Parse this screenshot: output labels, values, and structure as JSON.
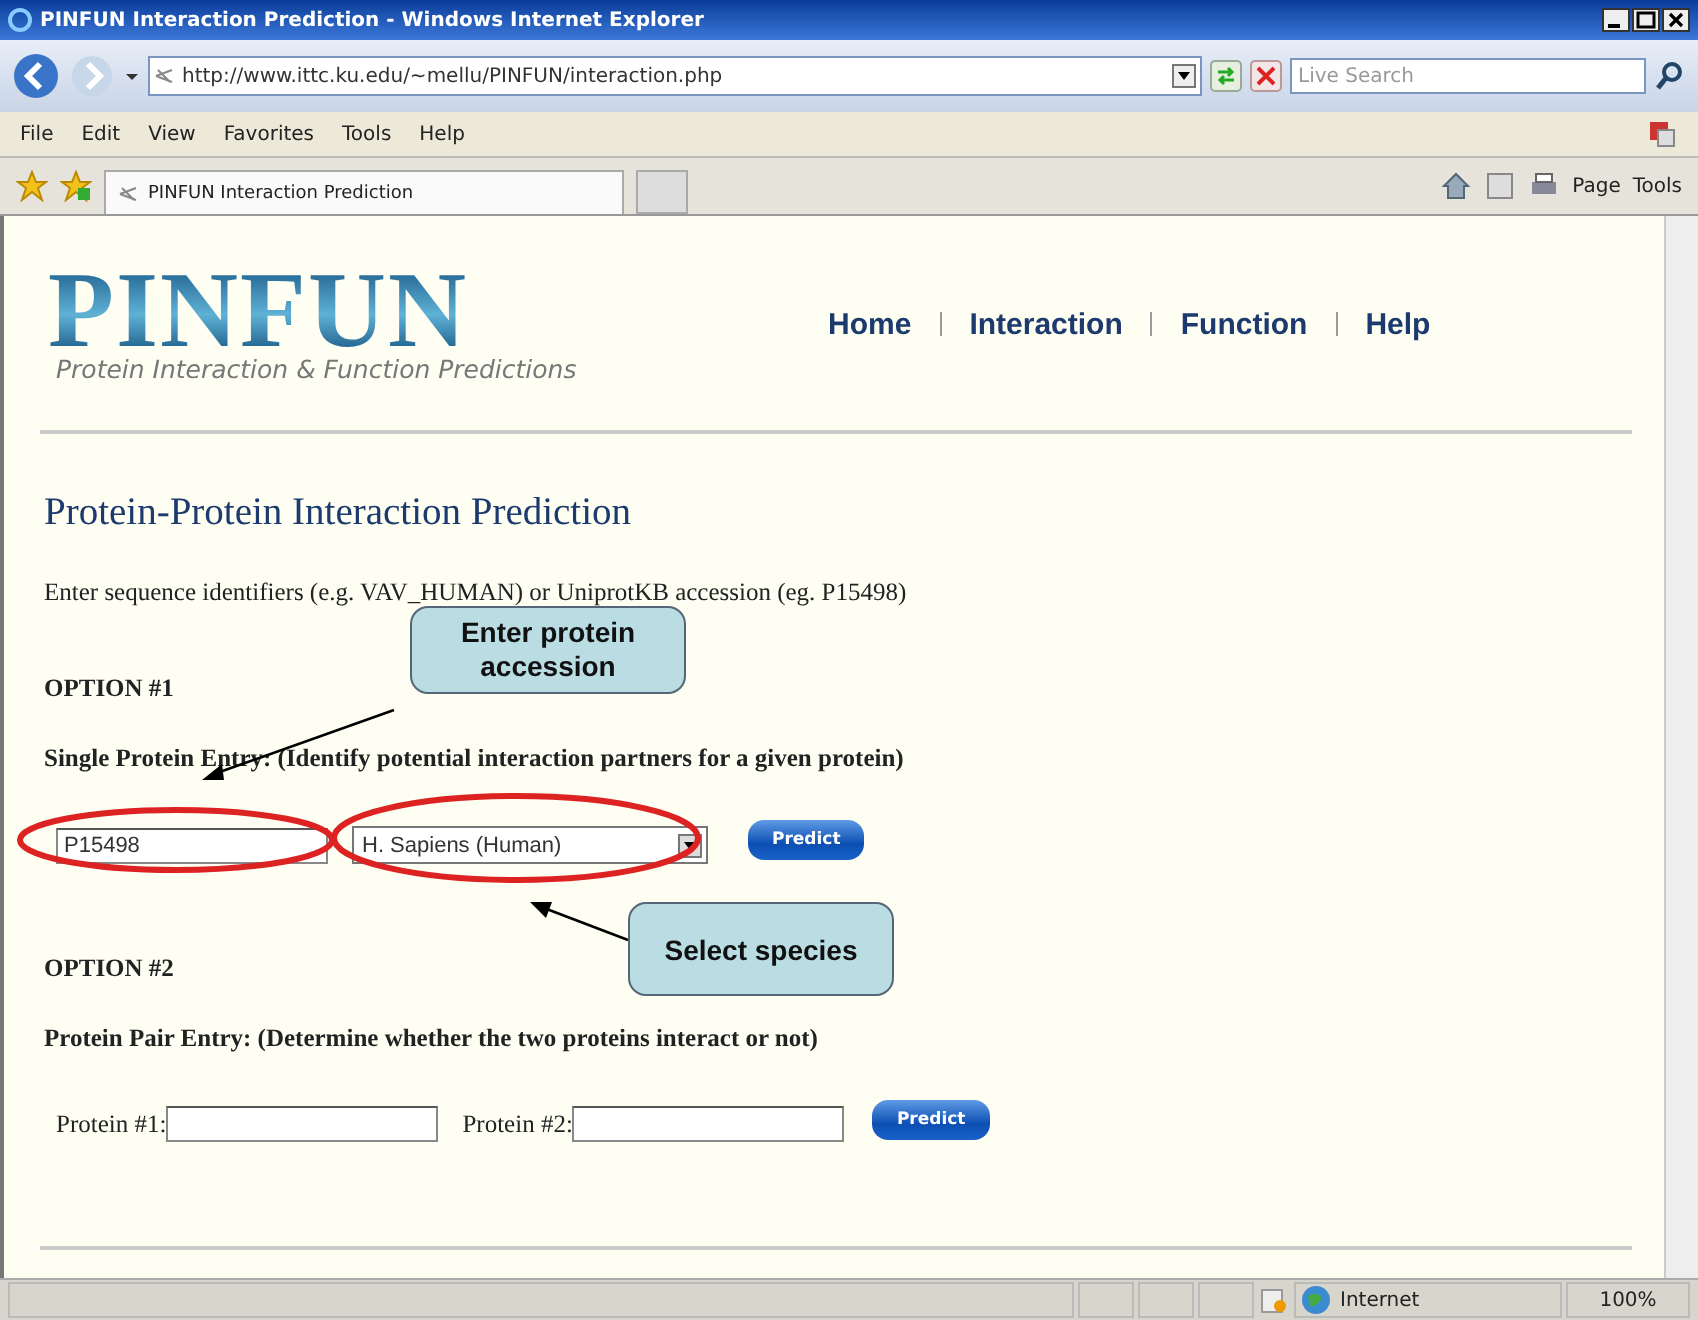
{
  "window": {
    "title": "PINFUN Interaction Prediction - Windows Internet Explorer"
  },
  "address_bar": {
    "url": "http://www.ittc.ku.edu/~mellu/PINFUN/interaction.php"
  },
  "search": {
    "placeholder": "Live Search"
  },
  "menu": [
    "File",
    "Edit",
    "View",
    "Favorites",
    "Tools",
    "Help"
  ],
  "tabs": [
    {
      "label": "PINFUN Interaction Prediction",
      "selected": true
    }
  ],
  "command_bar": [
    "Page",
    "Tools"
  ],
  "page": {
    "logo": "PINFUN",
    "tagline": "Protein Interaction & Function Predictions",
    "nav": [
      {
        "label": "Home"
      },
      {
        "label": "Interaction"
      },
      {
        "label": "Function"
      },
      {
        "label": "Help"
      }
    ],
    "heading": "Protein-Protein Interaction Prediction",
    "intro": "Enter sequence identifiers (e.g. VAV_HUMAN) or UniprotKB accession (eg. P15498)",
    "option1": {
      "title": "OPTION #1",
      "description": "Single Protein Entry: (Identify potential interaction partners for a given protein)",
      "accession": "P15498",
      "species": "H. Sapiens (Human)",
      "button": "Predict"
    },
    "option2": {
      "title": "OPTION #2",
      "description": "Protein Pair Entry: (Determine whether the two proteins interact or not)",
      "protein1_label": "Protein #1:",
      "protein2_label": "Protein #2:",
      "button": "Predict"
    }
  },
  "callouts": [
    {
      "text": "Enter protein accession"
    },
    {
      "text": "Select species"
    }
  ],
  "status_bar": {
    "zone": "Internet",
    "zoom": "100%"
  }
}
